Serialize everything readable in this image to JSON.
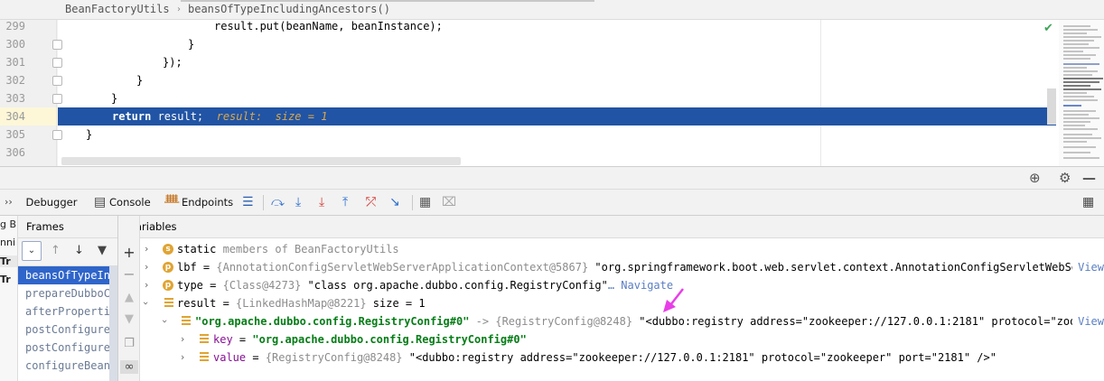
{
  "breadcrumb": {
    "class_name": "BeanFactoryUtils",
    "method_name": "beansOfTypeIncludingAncestors()"
  },
  "editor": {
    "lines": [
      {
        "num": "299",
        "code": "result.put(beanName, beanInstance);"
      },
      {
        "num": "300",
        "code": "}"
      },
      {
        "num": "301",
        "code": "});"
      },
      {
        "num": "302",
        "code": "}"
      },
      {
        "num": "303",
        "code": "}"
      },
      {
        "num": "304",
        "kw": "return",
        "code": " result;",
        "inline_value": "result:  size = 1"
      },
      {
        "num": "305",
        "code": "}"
      },
      {
        "num": "306",
        "code": ""
      }
    ]
  },
  "debug_toolbar": {
    "tabs": {
      "debugger": "Debugger",
      "console": "Console",
      "endpoints": "Endpoints"
    },
    "stub_lines": [
      "g B",
      "nni",
      "Tr",
      "Tr"
    ]
  },
  "frames": {
    "header": "Frames",
    "items": [
      "beansOfTypeIncl",
      "prepareDubboCon",
      "afterProperties",
      "postConfigureBe",
      "postConfigureBe",
      "configureBean:1"
    ]
  },
  "variables": {
    "header": "Variables",
    "rows": [
      {
        "badge": "s",
        "name": "static",
        "rest": " members of BeanFactoryUtils"
      },
      {
        "badge": "p",
        "name": "lbf",
        "eq": " = ",
        "ref": "{AnnotationConfigServletWebServerApplicationContext@5867}",
        "str": " \"org.springframework.boot.web.servlet.context.AnnotationConfigServletWebServ",
        "view": "View"
      },
      {
        "badge": "p",
        "name": "type",
        "eq": " = ",
        "ref": "{Class@4273}",
        "str": " \"class org.apache.dubbo.config.RegistryConfig\"",
        "action": "… Navigate"
      },
      {
        "name": "result",
        "eq": " = ",
        "ref": "{LinkedHashMap@8221}",
        "size": "  size = 1"
      },
      {
        "key": "\"org.apache.dubbo.config.RegistryConfig#0\"",
        "arrow": " -> ",
        "ref": "{RegistryConfig@8248}",
        "str": " \"<dubbo:registry address=\"zookeeper://127.0.0.1:2181\" protocol=\"zooke",
        "view": "View"
      },
      {
        "name": "key",
        "eq": " = ",
        "str": "\"org.apache.dubbo.config.RegistryConfig#0\""
      },
      {
        "name": "value",
        "eq": " = ",
        "ref": "{RegistryConfig@8248}",
        "str": " \"<dubbo:registry address=\"zookeeper://127.0.0.1:2181\" protocol=\"zookeeper\" port=\"2181\" />\""
      }
    ]
  },
  "colors": {
    "execution_line": "#2154a4",
    "selected_frame": "#2f65ca",
    "field_badge": "#e0a432",
    "string_value": "#067d17",
    "annotation_arrow": "#e83ee8"
  },
  "icons": [
    "check-icon",
    "crosshair-icon",
    "gear-icon",
    "minimize-icon",
    "layout-icon",
    "plus-icon",
    "minus-icon",
    "glasses-icon",
    "filter-icon"
  ]
}
